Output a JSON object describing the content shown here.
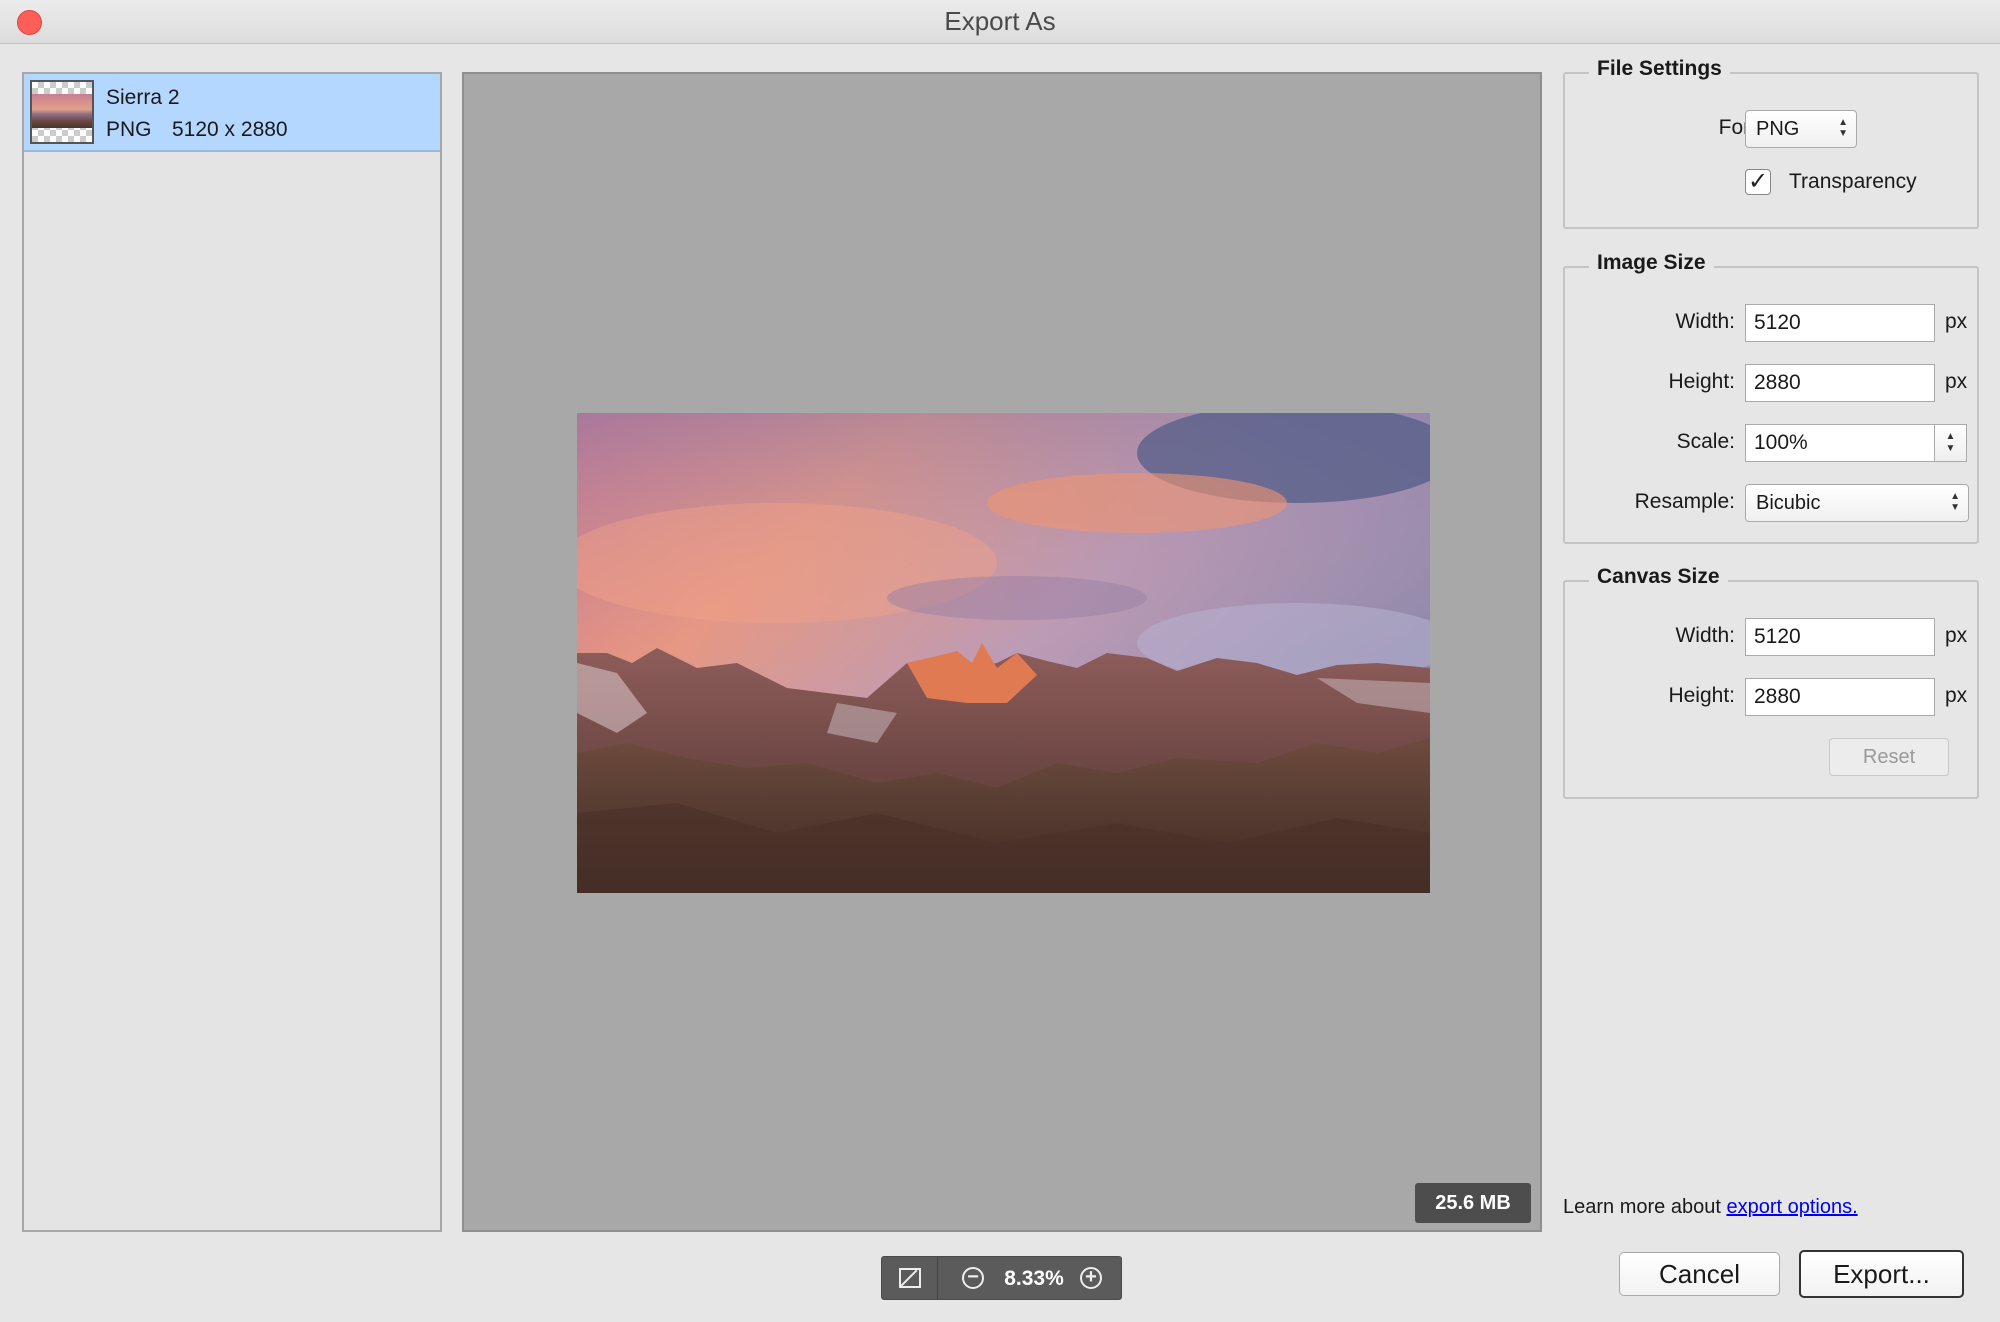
{
  "window": {
    "title": "Export As"
  },
  "assets": [
    {
      "name": "Sierra 2",
      "format": "PNG",
      "dimensions": "5120 x 2880"
    }
  ],
  "preview": {
    "file_size": "25.6 MB",
    "zoom": "8.33%"
  },
  "file_settings": {
    "title": "File Settings",
    "format_label": "Format:",
    "format_value": "PNG",
    "transparency_label": "Transparency",
    "transparency_checked": true,
    "check_glyph": "✓"
  },
  "image_size": {
    "title": "Image Size",
    "width_label": "Width:",
    "width_value": "5120",
    "height_label": "Height:",
    "height_value": "2880",
    "scale_label": "Scale:",
    "scale_value": "100%",
    "resample_label": "Resample:",
    "resample_value": "Bicubic",
    "unit": "px"
  },
  "canvas_size": {
    "title": "Canvas Size",
    "width_label": "Width:",
    "width_value": "5120",
    "height_label": "Height:",
    "height_value": "2880",
    "unit": "px",
    "reset_label": "Reset"
  },
  "footer": {
    "learn_prefix": "Learn more about",
    "learn_link": "export options.",
    "cancel_label": "Cancel",
    "export_label": "Export..."
  },
  "colors": {
    "selection": "#b3d7ff",
    "close": "#fc5f57",
    "link": "#0000ee"
  }
}
